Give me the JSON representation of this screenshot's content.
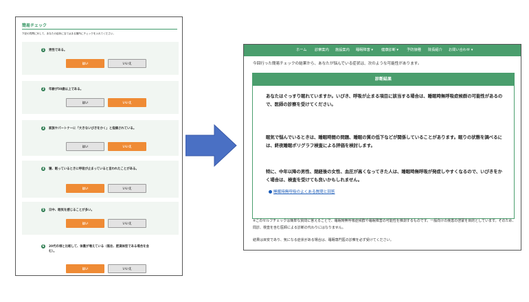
{
  "left": {
    "title": "簡易チェック",
    "intro": "下記の質問に対して、あなたの症状に当てはまる箇所にチェックを入れてください。",
    "yes_label": "はい",
    "no_label": "いいえ",
    "questions": [
      {
        "num": "1",
        "text": "男性である。",
        "answer": "yes"
      },
      {
        "num": "2",
        "text": "年齢が50歳以上である。",
        "answer": "no"
      },
      {
        "num": "3",
        "text": "家族やパートナーに「大きないびきをかく」と指摘されている。",
        "answer": "no"
      },
      {
        "num": "4",
        "text": "寝、眠っているときに呼吸が止まっていると言われたことがある。",
        "answer": "yes"
      },
      {
        "num": "5",
        "text": "日中、眠気を感じることが多い。",
        "answer": "yes"
      },
      {
        "num": "6",
        "text": "20代の頃と比較して、体重が増えている（既往、肥満体型である場合を含む）。",
        "answer": "yes"
      }
    ]
  },
  "right": {
    "nav": [
      "ホーム",
      "診察案内",
      "施設案内",
      "睡眠障害 ▾",
      "健康診断 ▾",
      "予防接種",
      "院長紹介",
      "お問い合わせ ▾"
    ],
    "intro": "今回行った簡易チェックの結果から、あなたが悩んでいる症状は、次のような可能性があります。",
    "result_title": "診断結果",
    "paragraphs": [
      "あなたはぐっすり眠れていますか。いびき、呼吸が止まる項目に該当する場合は、睡眠時無呼吸症候群の可能性があるので、医師の診察を受けてください。",
      "眠気で悩んでいるときは、睡眠時間の問題、睡眠の質の低下などが関係していることがあります。眠りの状態を調べるには、終夜睡眠ポリグラフ検査による評価を検討します。",
      "特に、中年以降の男性、閉経後の女性、血圧が高くなってきた人は、睡眠時無呼吸が発症しやすくなるので、いびきをかく場合は、検査を受けても良いかもしれません。"
    ],
    "link_text": "睡眠時無呼吸のよくある質問と回答",
    "note1": "※このセルフチェックは簡単な質問に答えることで、睡眠時無呼吸症候群や睡眠障害の可能性を推測するものです。一般向けの疾患の啓蒙を目的としています。そのため、問診、検査を含む医師による診断の代わりにはなりません。",
    "note2": "結果は目安であり、気になる症状がある場合は、睡眠専門医の診察を必ず受けてください。"
  },
  "colors": {
    "accent_green": "#4a9e6d",
    "yes_orange": "#ef8b35",
    "arrow_blue": "#4a70c4",
    "link_blue": "#1a5bb8"
  }
}
